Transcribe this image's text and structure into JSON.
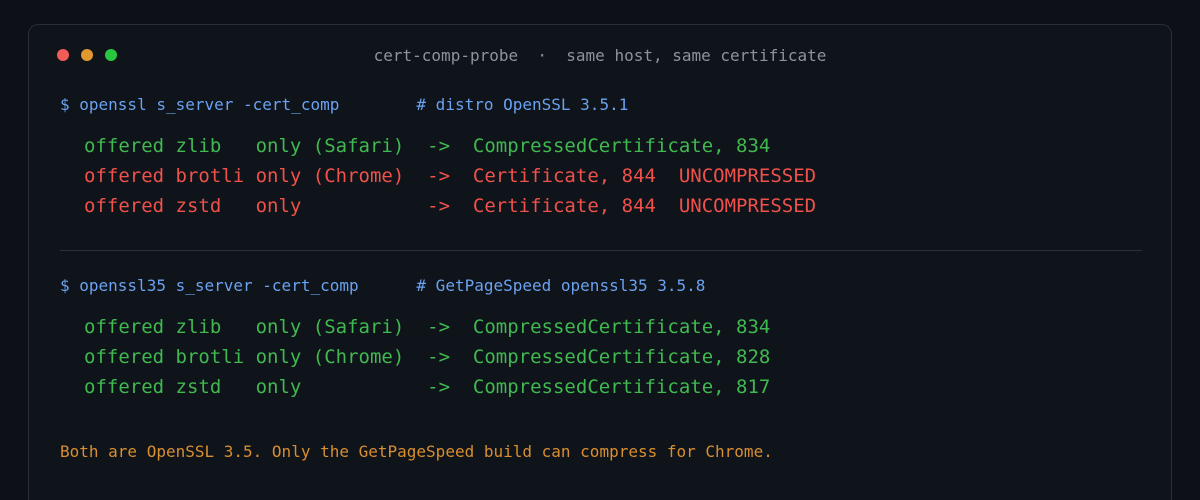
{
  "window": {
    "title": "cert-comp-probe  ·  same host, same certificate"
  },
  "blocks": [
    {
      "command": "$ openssl s_server -cert_comp        # distro OpenSSL 3.5.1",
      "rows": [
        {
          "text": "offered zlib   only (Safari)  ->  CompressedCertificate, 834",
          "status": "ok"
        },
        {
          "text": "offered brotli only (Chrome)  ->  Certificate, 844  UNCOMPRESSED",
          "status": "bad"
        },
        {
          "text": "offered zstd   only           ->  Certificate, 844  UNCOMPRESSED",
          "status": "bad"
        }
      ]
    },
    {
      "command": "$ openssl35 s_server -cert_comp      # GetPageSpeed openssl35 3.5.8",
      "rows": [
        {
          "text": "offered zlib   only (Safari)  ->  CompressedCertificate, 834",
          "status": "ok"
        },
        {
          "text": "offered brotli only (Chrome)  ->  CompressedCertificate, 828",
          "status": "ok"
        },
        {
          "text": "offered zstd   only           ->  CompressedCertificate, 817",
          "status": "ok"
        }
      ]
    }
  ],
  "note": "Both are OpenSSL 3.5. Only the GetPageSpeed build can compress for Chrome.",
  "colors": {
    "ok": "#3fb950",
    "bad": "#f0514b",
    "command": "#6aa2f0",
    "note": "#d98e2f"
  }
}
